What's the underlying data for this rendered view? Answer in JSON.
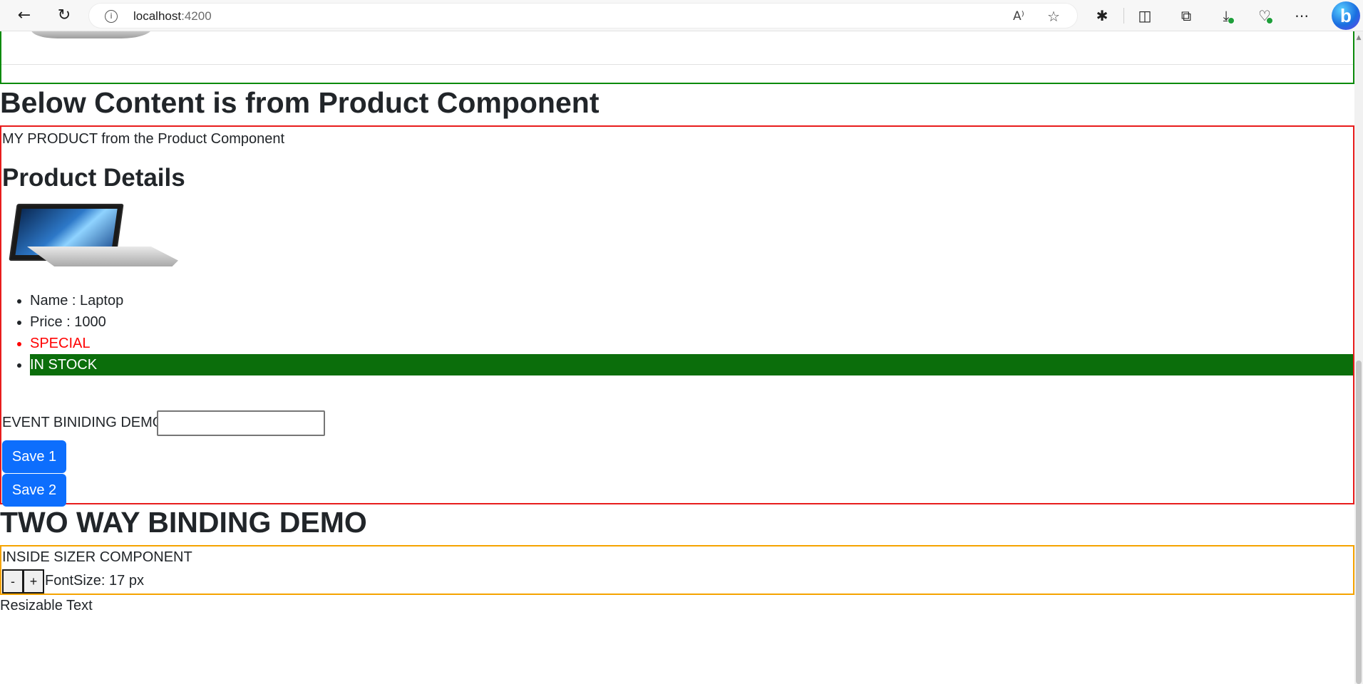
{
  "browser": {
    "url_host": "localhost",
    "url_port": ":4200",
    "icons": [
      "back-arrow-icon",
      "refresh-icon",
      "site-info-icon",
      "read-aloud-icon",
      "favorite-star-icon",
      "extensions-icon",
      "split-screen-icon",
      "collections-icon",
      "downloads-icon",
      "browser-essentials-icon",
      "more-menu-icon",
      "bing-copilot-icon"
    ]
  },
  "page": {
    "product_section_title": "Below Content is from Product Component",
    "product_intro": "MY PRODUCT from the Product Component",
    "product_heading": "Product Details",
    "details": [
      "Name : Laptop",
      "Price : 1000",
      "SPECIAL",
      "IN STOCK"
    ],
    "event_label": "EVENT BINIDING DEMO",
    "event_input_value": "",
    "save1": "Save 1",
    "save2": "Save 2",
    "two_way_title": "TWO WAY BINDING DEMO",
    "sizer_title": "INSIDE SIZER COMPONENT",
    "minus": "-",
    "plus": "+",
    "fontsize_label": "FontSize: 17 px",
    "resizable_text": "Resizable Text"
  },
  "colors": {
    "prev_component_border": "#0b8a0b",
    "product_border": "#e81c1c",
    "special_text": "#ff0000",
    "in_stock_bg": "#0b6e0b",
    "primary_button": "#0d6efd",
    "sizer_border": "#f5a300"
  }
}
